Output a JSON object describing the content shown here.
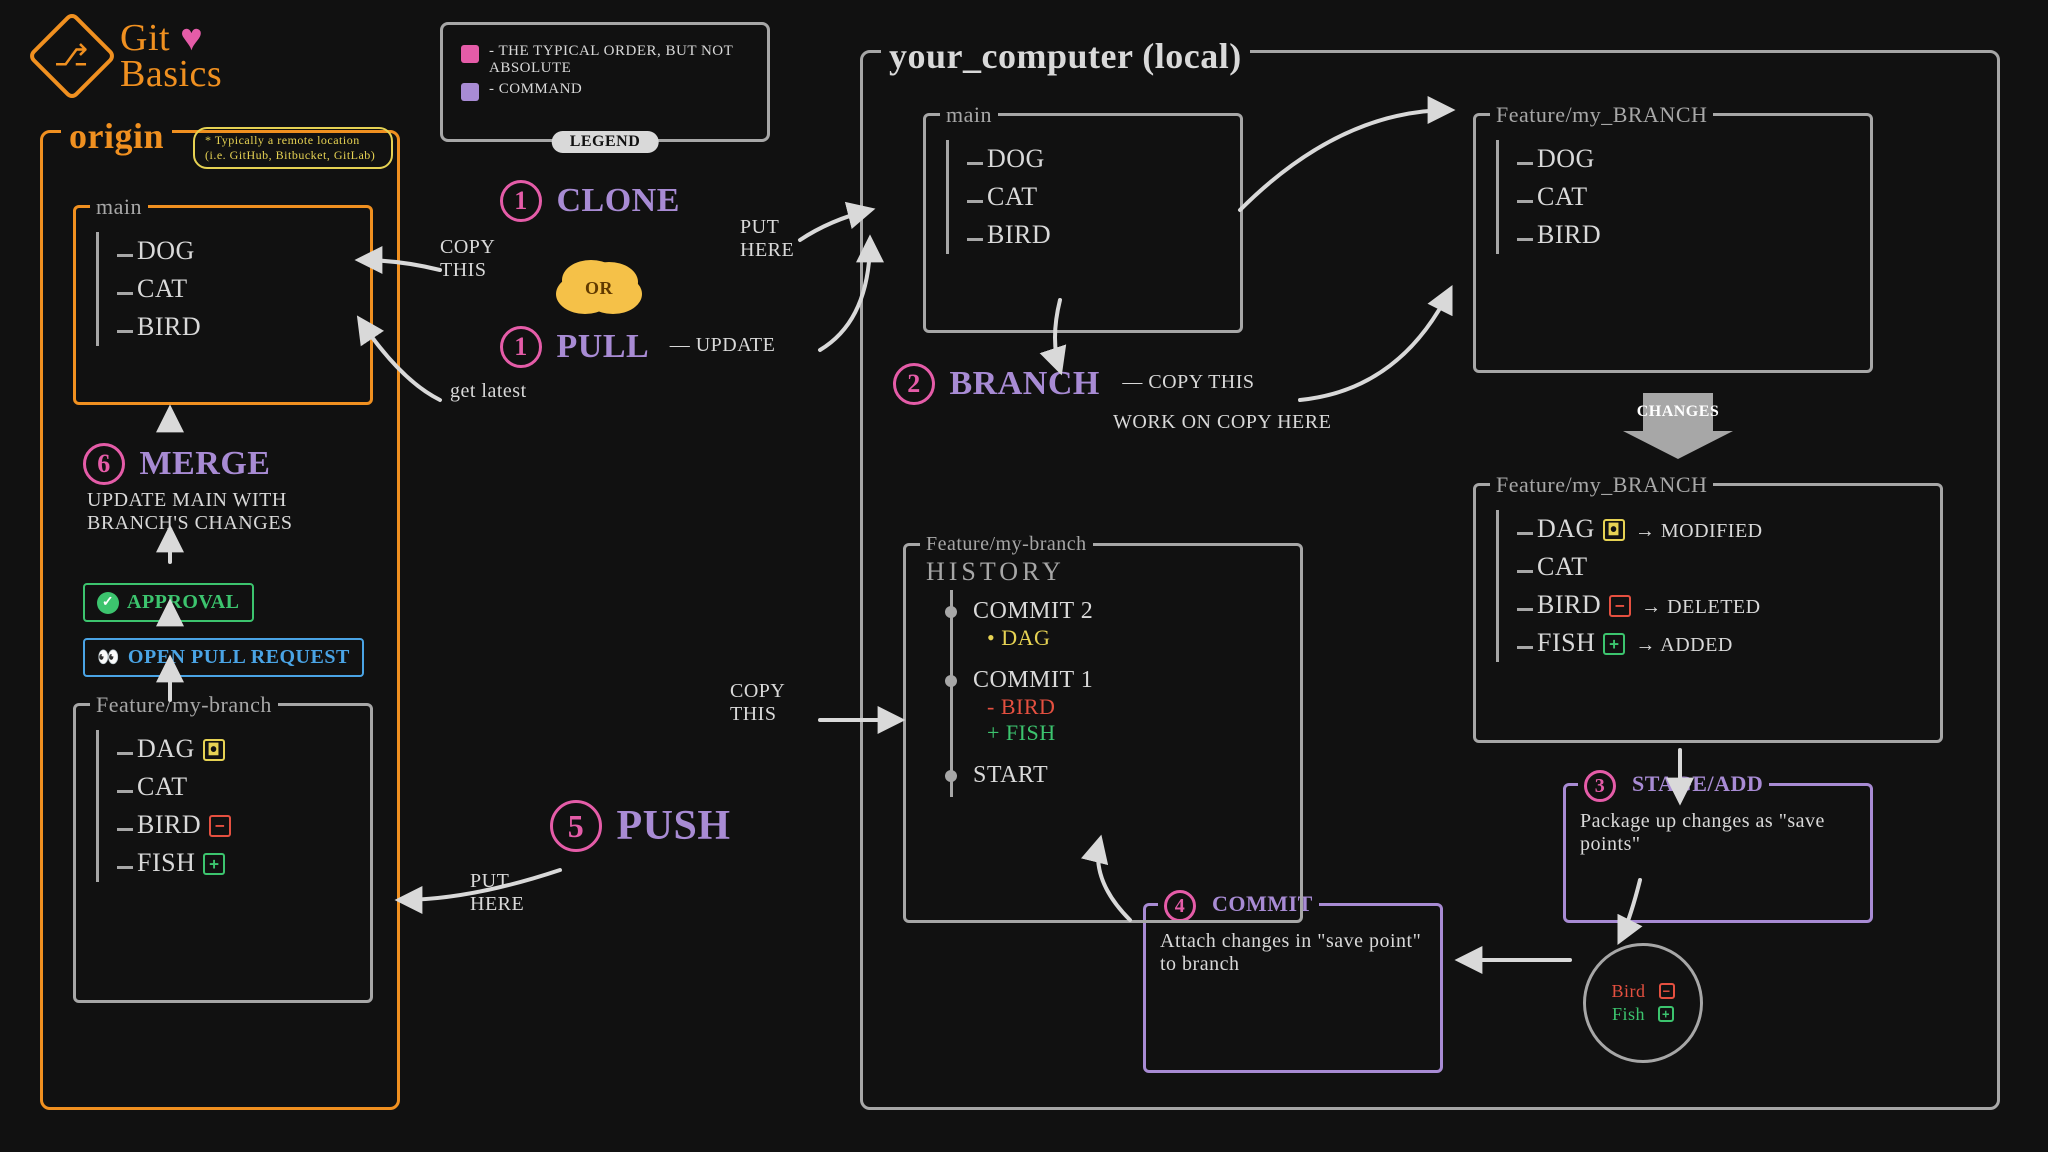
{
  "title": {
    "line1": "Git",
    "line2": "Basics",
    "heart": "♥"
  },
  "legend": {
    "items": [
      {
        "color": "#e55ca8",
        "text": "THE TYPICAL ORDER, BUT NOT ABSOLUTE"
      },
      {
        "color": "#a88bd4",
        "text": "COMMAND"
      }
    ],
    "badge": "LEGEND"
  },
  "or": "OR",
  "origin": {
    "title": "origin",
    "tooltip": "* Typically a remote location (i.e. GitHub, Bitbucket, GitLab)",
    "main": {
      "title": "main",
      "files": [
        "DOG",
        "CAT",
        "BIRD"
      ]
    },
    "merge": {
      "num": "6",
      "cmd": "MERGE",
      "note": "Update main with branch's changes"
    },
    "approval": "Approval",
    "pr": "OPEN PULL REQUEST",
    "feature": {
      "title": "Feature/my-branch",
      "files": [
        {
          "name": "DAG",
          "status": "modified"
        },
        {
          "name": "CAT",
          "status": "none"
        },
        {
          "name": "BIRD",
          "status": "deleted"
        },
        {
          "name": "FISH",
          "status": "added"
        }
      ]
    }
  },
  "steps": {
    "clone": {
      "num": "1",
      "cmd": "CLONE",
      "left": "COPY THIS",
      "right": "PUT HERE"
    },
    "pull": {
      "num": "1",
      "cmd": "PULL",
      "right": "UPDATE",
      "left": "get latest"
    },
    "branch": {
      "num": "2",
      "cmd": "BRANCH",
      "a": "COPY THIS",
      "b": "WORK ON COPY HERE"
    },
    "stage": {
      "num": "3",
      "cmd": "STAGE/ADD",
      "note": "Package up changes as \"save points\""
    },
    "commit": {
      "num": "4",
      "cmd": "COMMIT",
      "note": "Attach changes in \"save point\" to branch"
    },
    "push": {
      "num": "5",
      "cmd": "PUSH",
      "left": "PUT HERE",
      "right": "COPY THIS"
    }
  },
  "local": {
    "title": "your_computer (local)",
    "main": {
      "title": "main",
      "files": [
        "DOG",
        "CAT",
        "BIRD"
      ]
    },
    "feature_clean": {
      "title": "Feature/my_BRANCH",
      "files": [
        "DOG",
        "CAT",
        "BIRD"
      ]
    },
    "changes_label": "CHANGES",
    "feature_dirty": {
      "title": "Feature/my_BRANCH",
      "files": [
        {
          "name": "DAG",
          "status": "modified",
          "note": "MODIFIED"
        },
        {
          "name": "CAT",
          "status": "none"
        },
        {
          "name": "BIRD",
          "status": "deleted",
          "note": "DELETED"
        },
        {
          "name": "FISH",
          "status": "added",
          "note": "ADDED"
        }
      ]
    },
    "savepoint": [
      {
        "name": "Bird",
        "status": "deleted"
      },
      {
        "name": "Fish",
        "status": "added"
      }
    ],
    "history": {
      "title": "Feature/my-branch",
      "sub": "HISTORY",
      "commits": [
        {
          "label": "COMMIT 2",
          "lines": [
            {
              "sym": "•",
              "text": "DAG",
              "cls": "yellow"
            }
          ]
        },
        {
          "label": "COMMIT 1",
          "lines": [
            {
              "sym": "-",
              "text": "BIRD",
              "cls": "red"
            },
            {
              "sym": "+",
              "text": "FISH",
              "cls": "green"
            }
          ]
        },
        {
          "label": "START",
          "lines": []
        }
      ]
    }
  },
  "status_glyph": {
    "modified": "◘",
    "deleted": "−",
    "added": "+"
  }
}
